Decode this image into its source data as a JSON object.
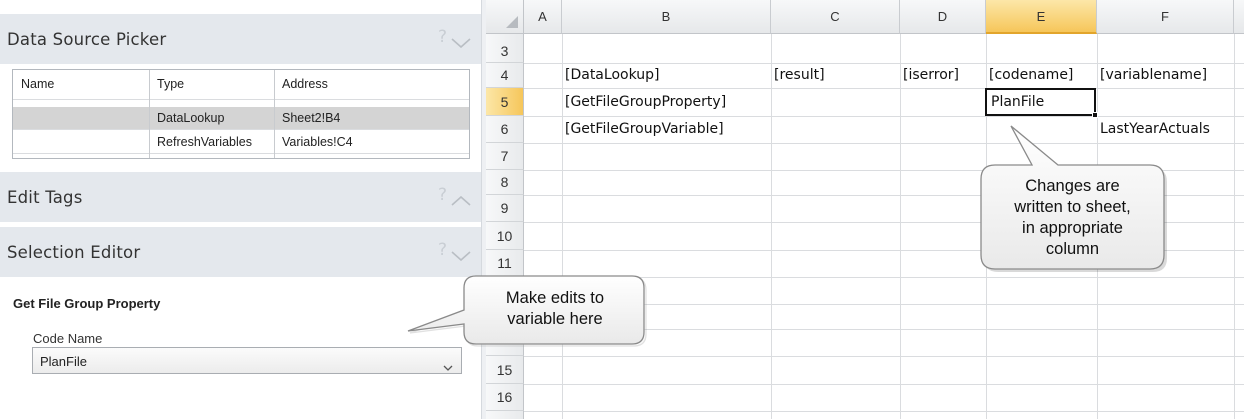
{
  "pane": {
    "data_source_picker": {
      "title": "Data Source Picker",
      "help": "?"
    },
    "table": {
      "headers": [
        "Name",
        "Type",
        "Address"
      ],
      "rows": [
        {
          "name": "",
          "type": "DataLookup",
          "address": "Sheet2!B4",
          "selected": true
        },
        {
          "name": "",
          "type": "RefreshVariables",
          "address": "Variables!C4",
          "selected": false
        }
      ]
    },
    "edit_tags": {
      "title": "Edit Tags",
      "help": "?"
    },
    "selection_editor": {
      "title": "Selection Editor",
      "help": "?"
    },
    "editor": {
      "title": "Get File Group Property",
      "field_label": "Code Name",
      "field_value": "PlanFile"
    }
  },
  "sheet": {
    "columns": [
      "A",
      "B",
      "C",
      "D",
      "E",
      "F"
    ],
    "active_column": "E",
    "rows": [
      "3",
      "4",
      "5",
      "6",
      "7",
      "8",
      "9",
      "10",
      "11",
      "",
      "",
      "",
      "15",
      "16"
    ],
    "active_row": "5",
    "cells": {
      "B4": "[DataLookup]",
      "C4": "[result]",
      "D4": "[iserror]",
      "E4": "[codename]",
      "F4": "[variablename]",
      "B5": "[GetFileGroupProperty]",
      "E5": "PlanFile",
      "B6": "[GetFileGroupVariable]",
      "F6": "LastYearActuals"
    }
  },
  "callouts": {
    "left": {
      "lines": [
        "Make edits to",
        "variable here"
      ]
    },
    "right": {
      "lines": [
        "Changes are",
        "written to sheet,",
        "in appropriate",
        "column"
      ]
    }
  },
  "colors": {
    "pane_header_bg": "#e4e8ed",
    "selected_row_bg": "#d4d4d4",
    "active_header_bg": "#f6c65a",
    "grid_line": "#dadcdf"
  }
}
